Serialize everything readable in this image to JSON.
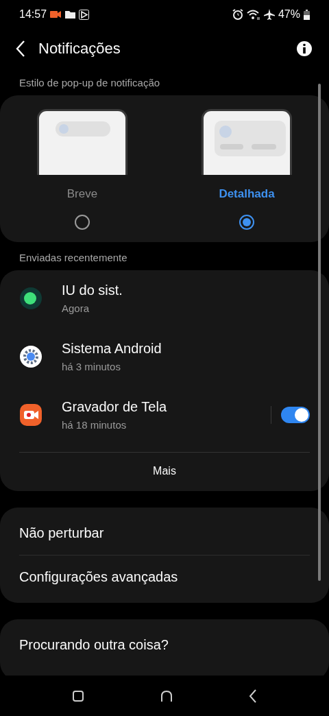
{
  "status_bar": {
    "time": "14:57",
    "battery": "47%"
  },
  "header": {
    "title": "Notificações"
  },
  "popup_style": {
    "label": "Estilo de pop-up de notificação",
    "options": [
      {
        "label": "Breve",
        "kind": "brief",
        "selected": false
      },
      {
        "label": "Detalhada",
        "kind": "detailed",
        "selected": true
      }
    ]
  },
  "recent": {
    "label": "Enviadas recentemente",
    "apps": [
      {
        "name": "IU do sist.",
        "time": "Agora",
        "kind": "system-ui"
      },
      {
        "name": "Sistema Android",
        "time": "há 3 minutos",
        "kind": "android"
      },
      {
        "name": "Gravador de Tela",
        "time": "há 18 minutos",
        "kind": "recorder",
        "toggle": {
          "on": true
        }
      }
    ],
    "more": "Mais"
  },
  "settings": [
    {
      "label": "Não perturbar"
    },
    {
      "label": "Configurações avançadas"
    }
  ],
  "footer": {
    "title": "Procurando outra coisa?"
  }
}
